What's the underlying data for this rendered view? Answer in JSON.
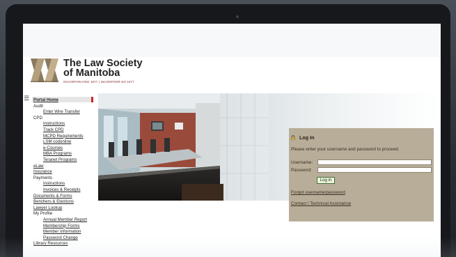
{
  "header": {
    "title_line1": "The Law Society",
    "title_line2": "of Manitoba",
    "subtitle": "INCORPORATED 1877 | INCORPORÉ EN 1877",
    "logo_icon": "law-society-logo-icon"
  },
  "sidebar": {
    "toggle_icon": "hamburger-menu-icon",
    "items": [
      {
        "label": "Portal Home",
        "link": true,
        "indent": 0,
        "active": true
      },
      {
        "label": "Audit",
        "link": false,
        "indent": 0
      },
      {
        "label": "Enter Wire Transfer",
        "link": true,
        "indent": 1
      },
      {
        "label": "CPD",
        "link": false,
        "indent": 0
      },
      {
        "label": "Instructions",
        "link": true,
        "indent": 1
      },
      {
        "label": "Track CPD",
        "link": true,
        "indent": 1
      },
      {
        "label": "MCPD Requirements",
        "link": true,
        "indent": 1
      },
      {
        "label": "LSM codonline",
        "link": true,
        "indent": 1
      },
      {
        "label": "e-Courses",
        "link": true,
        "indent": 1
      },
      {
        "label": "MBA Programs",
        "link": true,
        "indent": 1
      },
      {
        "label": "Teranet Programs",
        "link": true,
        "indent": 1
      },
      {
        "label": "eLaw",
        "link": true,
        "indent": 0
      },
      {
        "label": "Insurance",
        "link": true,
        "indent": 0
      },
      {
        "label": "Payments",
        "link": false,
        "indent": 0
      },
      {
        "label": "Instructions",
        "link": true,
        "indent": 1
      },
      {
        "label": "Invoices & Receipts",
        "link": true,
        "indent": 1
      },
      {
        "label": "Documents & Forms",
        "link": true,
        "indent": 0
      },
      {
        "label": "Benchers & Elections",
        "link": true,
        "indent": 0
      },
      {
        "label": "Lawyer Lookup",
        "link": true,
        "indent": 0
      },
      {
        "label": "My Profile",
        "link": false,
        "indent": 0
      },
      {
        "label": "Annual Member Report",
        "link": true,
        "indent": 1
      },
      {
        "label": "Membership Forms",
        "link": true,
        "indent": 1
      },
      {
        "label": "Member Information",
        "link": true,
        "indent": 1
      },
      {
        "label": "Password Change",
        "link": true,
        "indent": 1
      },
      {
        "label": "Library Resources",
        "link": true,
        "indent": 0
      }
    ]
  },
  "login": {
    "icon": "lock-icon",
    "title": "Log In",
    "message": "Please enter your username and password to proceed.",
    "username_label": "Username:",
    "username_value": "",
    "password_label": "Password:",
    "password_value": "",
    "button_label": "Log in",
    "forgot_link": "Forgot username/password",
    "contact_link": "Contact / Technical Assistance"
  },
  "colors": {
    "accent": "#cc2229",
    "panel_bg": "#b8ad98",
    "button_bg": "#e9f5d9",
    "logo_brown": "#8b7a5e",
    "subtitle_red": "#8a2b2b"
  }
}
